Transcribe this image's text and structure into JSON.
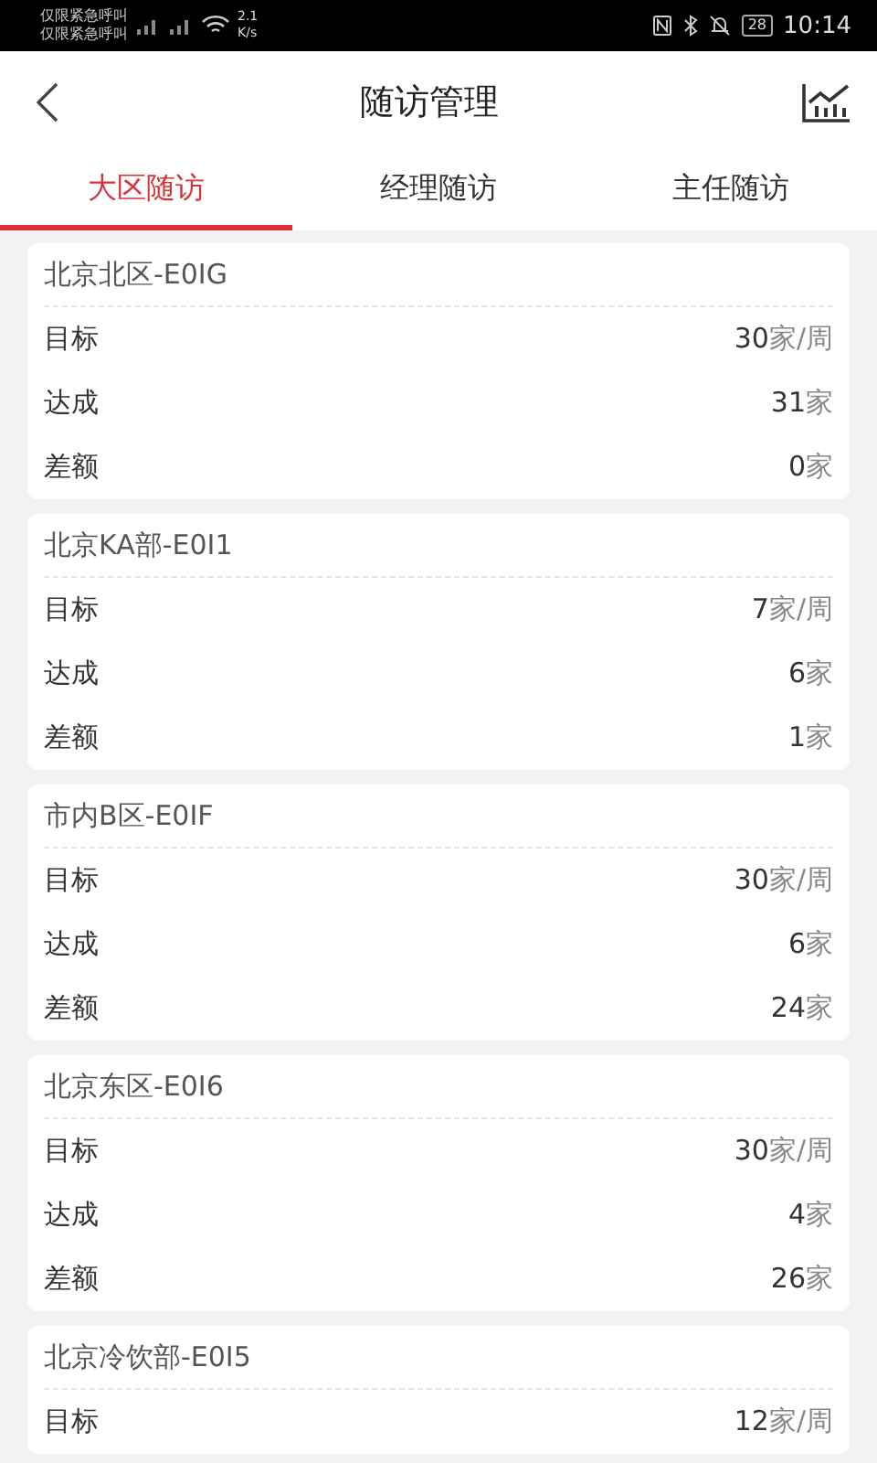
{
  "status_bar": {
    "carrier_lines": [
      "仅限紧急呼叫",
      "仅限紧急呼叫"
    ],
    "speed": "2.1",
    "speed_unit": "K/s",
    "battery": "28",
    "time": "10:14"
  },
  "header": {
    "title": "随访管理"
  },
  "tabs": [
    {
      "label": "大区随访",
      "selected": true
    },
    {
      "label": "经理随访",
      "selected": false
    },
    {
      "label": "主任随访",
      "selected": false
    }
  ],
  "cards": [
    {
      "title": "北京北区-E0IG",
      "rows": [
        {
          "label": "目标",
          "value": "30",
          "unit": "家/周"
        },
        {
          "label": "达成",
          "value": "31",
          "unit": "家"
        },
        {
          "label": "差额",
          "value": "0",
          "unit": "家"
        }
      ]
    },
    {
      "title": "北京KA部-E0I1",
      "rows": [
        {
          "label": "目标",
          "value": "7",
          "unit": "家/周"
        },
        {
          "label": "达成",
          "value": "6",
          "unit": "家"
        },
        {
          "label": "差额",
          "value": "1",
          "unit": "家"
        }
      ]
    },
    {
      "title": "市内B区-E0IF",
      "rows": [
        {
          "label": "目标",
          "value": "30",
          "unit": "家/周"
        },
        {
          "label": "达成",
          "value": "6",
          "unit": "家"
        },
        {
          "label": "差额",
          "value": "24",
          "unit": "家"
        }
      ]
    },
    {
      "title": "北京东区-E0I6",
      "rows": [
        {
          "label": "目标",
          "value": "30",
          "unit": "家/周"
        },
        {
          "label": "达成",
          "value": "4",
          "unit": "家"
        },
        {
          "label": "差额",
          "value": "26",
          "unit": "家"
        }
      ]
    },
    {
      "title": "北京冷饮部-E0I5",
      "rows": [
        {
          "label": "目标",
          "value": "12",
          "unit": "家/周"
        }
      ]
    }
  ]
}
